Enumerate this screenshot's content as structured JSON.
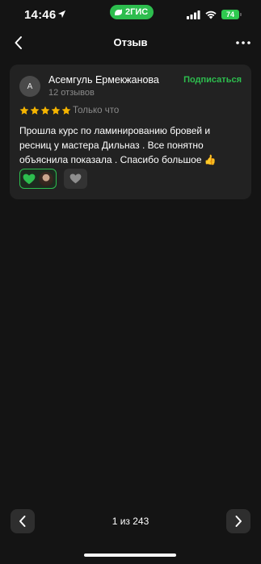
{
  "status_bar": {
    "time": "14:46",
    "app_badge": "2ГИС",
    "battery": "74"
  },
  "nav": {
    "title": "Отзыв"
  },
  "review": {
    "avatar_letter": "А",
    "author": "Асемгуль Ермекжанова",
    "reviews_count": "12 отзывов",
    "subscribe_label": "Подписаться",
    "rating": 5,
    "date": "Только что",
    "text": "Прошла курс по ламинированию бровей и ресниц у мастера Дильназ . Все понятно объяснила показала . Спасибо большое 👍"
  },
  "pager": {
    "indicator": "1 из 243"
  },
  "colors": {
    "accent_green": "#2dbd4e",
    "background": "#141414",
    "card": "#222222",
    "star": "#f5b400"
  }
}
